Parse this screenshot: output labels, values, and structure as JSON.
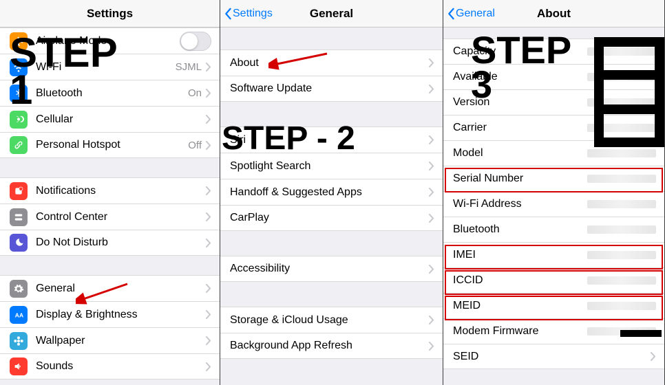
{
  "panel1": {
    "title": "Settings",
    "step_label": "STEP\n1",
    "rows_g1": [
      {
        "name": "airplane",
        "label": "Airplane Mode",
        "value": "",
        "toggle": true,
        "color": "c-orange",
        "icon": "plane-icon"
      },
      {
        "name": "wifi",
        "label": "Wi-Fi",
        "value": "SJML",
        "color": "c-blue",
        "icon": "wifi-icon"
      },
      {
        "name": "bluetooth",
        "label": "Bluetooth",
        "value": "On",
        "color": "c-blue2",
        "icon": "bluetooth-icon"
      },
      {
        "name": "cellular",
        "label": "Cellular",
        "value": "",
        "color": "c-green",
        "icon": "antenna-icon"
      },
      {
        "name": "hotspot",
        "label": "Personal Hotspot",
        "value": "Off",
        "color": "c-green2",
        "icon": "link-icon"
      }
    ],
    "rows_g2": [
      {
        "name": "notifications",
        "label": "Notifications",
        "value": "",
        "color": "c-red",
        "icon": "notification-icon"
      },
      {
        "name": "control-center",
        "label": "Control Center",
        "value": "",
        "color": "c-gray",
        "icon": "switches-icon"
      },
      {
        "name": "dnd",
        "label": "Do Not Disturb",
        "value": "",
        "color": "c-purple",
        "icon": "moon-icon"
      }
    ],
    "rows_g3": [
      {
        "name": "general",
        "label": "General",
        "value": "",
        "color": "c-gray",
        "icon": "gear-icon"
      },
      {
        "name": "display",
        "label": "Display & Brightness",
        "value": "",
        "color": "c-blue",
        "icon": "aa-icon"
      },
      {
        "name": "wallpaper",
        "label": "Wallpaper",
        "value": "",
        "color": "c-bblue",
        "icon": "flower-icon"
      },
      {
        "name": "sounds",
        "label": "Sounds",
        "value": "",
        "color": "c-red",
        "icon": "speaker-icon"
      }
    ]
  },
  "panel2": {
    "back": "Settings",
    "title": "General",
    "step_label": "STEP - 2",
    "g1": [
      {
        "name": "about",
        "label": "About"
      },
      {
        "name": "software-update",
        "label": "Software Update"
      }
    ],
    "g2": [
      {
        "name": "siri",
        "label": "Siri"
      },
      {
        "name": "spotlight",
        "label": "Spotlight Search"
      },
      {
        "name": "handoff",
        "label": "Handoff & Suggested Apps"
      },
      {
        "name": "carplay",
        "label": "CarPlay"
      }
    ],
    "g3": [
      {
        "name": "accessibility",
        "label": "Accessibility"
      }
    ],
    "g4": [
      {
        "name": "storage",
        "label": "Storage & iCloud Usage"
      },
      {
        "name": "bg-refresh",
        "label": "Background App Refresh"
      }
    ]
  },
  "panel3": {
    "back": "General",
    "title": "About",
    "step_label": "STEP\n3",
    "rows": [
      {
        "name": "capacity",
        "label": "Capacity",
        "value": ""
      },
      {
        "name": "available",
        "label": "Available",
        "value": ""
      },
      {
        "name": "version",
        "label": "Version",
        "value": ""
      },
      {
        "name": "carrier",
        "label": "Carrier",
        "value": ""
      },
      {
        "name": "model",
        "label": "Model",
        "value": ""
      },
      {
        "name": "serial",
        "label": "Serial Number",
        "value": ""
      },
      {
        "name": "wifi-addr",
        "label": "Wi-Fi Address",
        "value": ""
      },
      {
        "name": "bt-addr",
        "label": "Bluetooth",
        "value": ""
      },
      {
        "name": "imei",
        "label": "IMEI",
        "value": ""
      },
      {
        "name": "iccid",
        "label": "ICCID",
        "value": ""
      },
      {
        "name": "meid",
        "label": "MEID",
        "value": ""
      },
      {
        "name": "modem",
        "label": "Modem Firmware",
        "value": ""
      },
      {
        "name": "seid",
        "label": "SEID",
        "value": "",
        "chev": true
      }
    ]
  }
}
